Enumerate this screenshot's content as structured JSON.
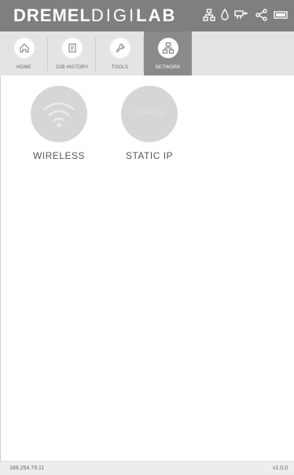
{
  "header": {
    "brand_bold": "DREMEL",
    "brand_light": "DIGI",
    "brand_bold2": "LAB",
    "icons": [
      "network-status-icon",
      "filament-status-icon",
      "extruder-status-icon",
      "share-icon",
      "battery-icon"
    ]
  },
  "tabs": [
    {
      "label": "HOME",
      "icon": "home-icon",
      "active": false
    },
    {
      "label": "JOB HISTORY",
      "icon": "job-history-icon",
      "active": false
    },
    {
      "label": "TOOLS",
      "icon": "wrench-icon",
      "active": false
    },
    {
      "label": "NETWORK",
      "icon": "network-icon",
      "active": true
    }
  ],
  "network": {
    "wireless_label": "WIRELESS",
    "static_ip_label": "STATIC IP",
    "static_ip_placeholder": "000.000.000"
  },
  "footer": {
    "ip_address": "169.254.73.11",
    "version": "v1.0.0"
  },
  "colors": {
    "header_bg": "#7f7f7f",
    "tab_bar_bg": "#e4e4e4",
    "active_tab_bg": "#8a8a8a",
    "option_circle": "#d6d6d6"
  }
}
